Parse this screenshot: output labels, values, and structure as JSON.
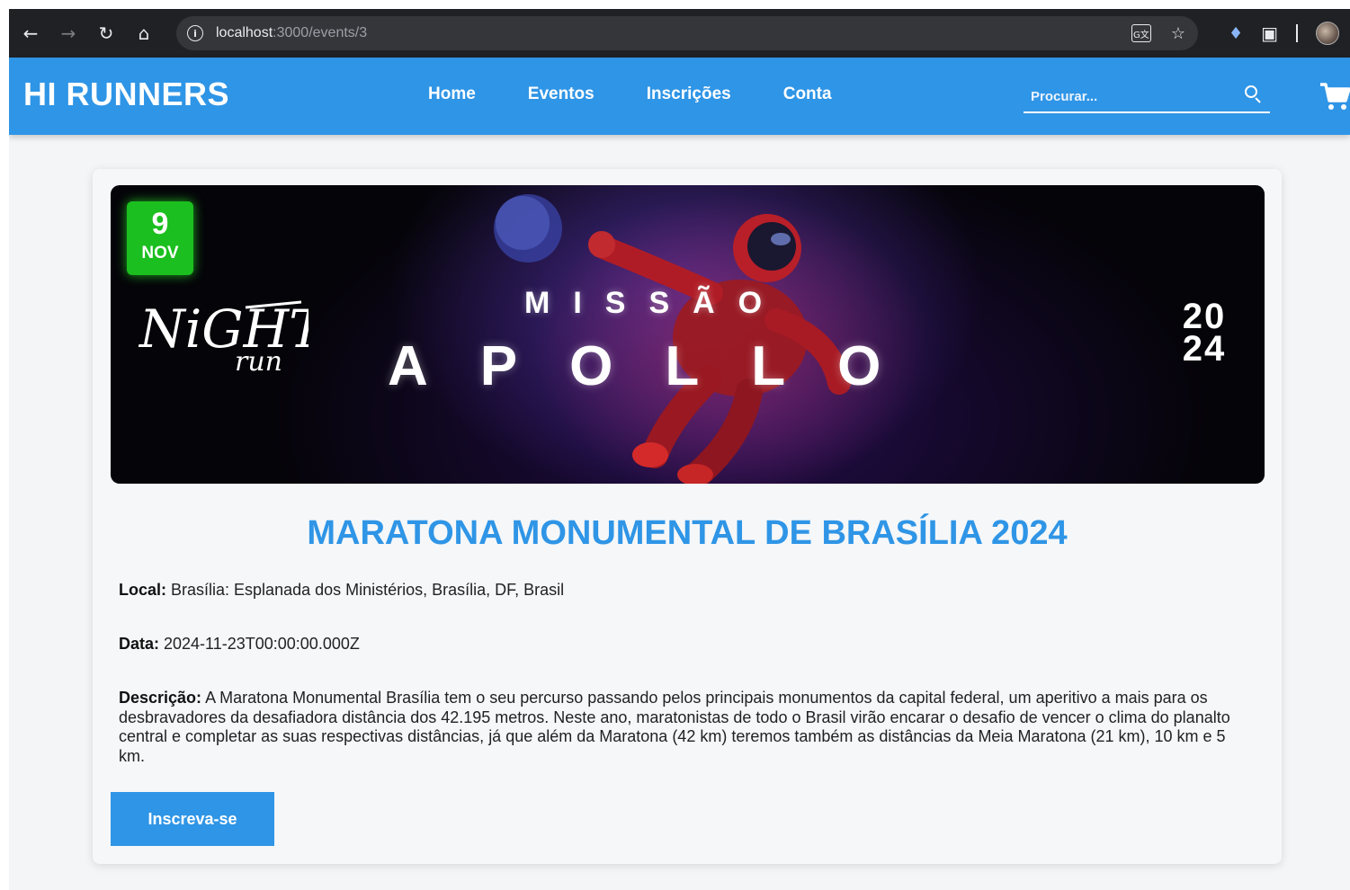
{
  "browser": {
    "url_host": "localhost",
    "url_path": ":3000/events/3",
    "icons": [
      "back-arrow-icon",
      "forward-arrow-icon",
      "reload-icon",
      "home-icon",
      "info-icon",
      "translate-icon",
      "star-icon",
      "extension-icon",
      "puzzle-icon",
      "profile-avatar"
    ]
  },
  "header": {
    "brand": "HI RUNNERS",
    "menu": [
      "Home",
      "Eventos",
      "Inscrições",
      "Conta"
    ],
    "search_placeholder": "Procurar...",
    "accent_color": "#2f95e6"
  },
  "event": {
    "banner": {
      "day": "9",
      "month": "NOV",
      "logo_text": "NiGHT run",
      "headline_top": "MISSÃO",
      "headline_bottom": "APOLLO",
      "year_top": "20",
      "year_bottom": "24"
    },
    "title": "MARATONA MONUMENTAL DE BRASÍLIA 2024",
    "local_label": "Local:",
    "local_value": " Brasília: Esplanada dos Ministérios, Brasília, DF, Brasil",
    "date_label": "Data:",
    "date_value": " 2024-11-23T00:00:00.000Z",
    "description_label": "Descrição:",
    "description_value": " A Maratona Monumental Brasília tem o seu percurso passando pelos principais monumentos da capital federal, um aperitivo a mais para os desbravadores da desafiadora distância dos 42.195 metros. Neste ano, maratonistas de todo o Brasil virão encarar o desafio de vencer o clima do planalto central e completar as suas respectivas distâncias, já que além da Maratona (42 km) teremos também as distâncias da Meia Maratona (21 km), 10 km e 5 km.",
    "subscribe_label": "Inscreva-se",
    "badge_color": "#1bbf1f"
  }
}
